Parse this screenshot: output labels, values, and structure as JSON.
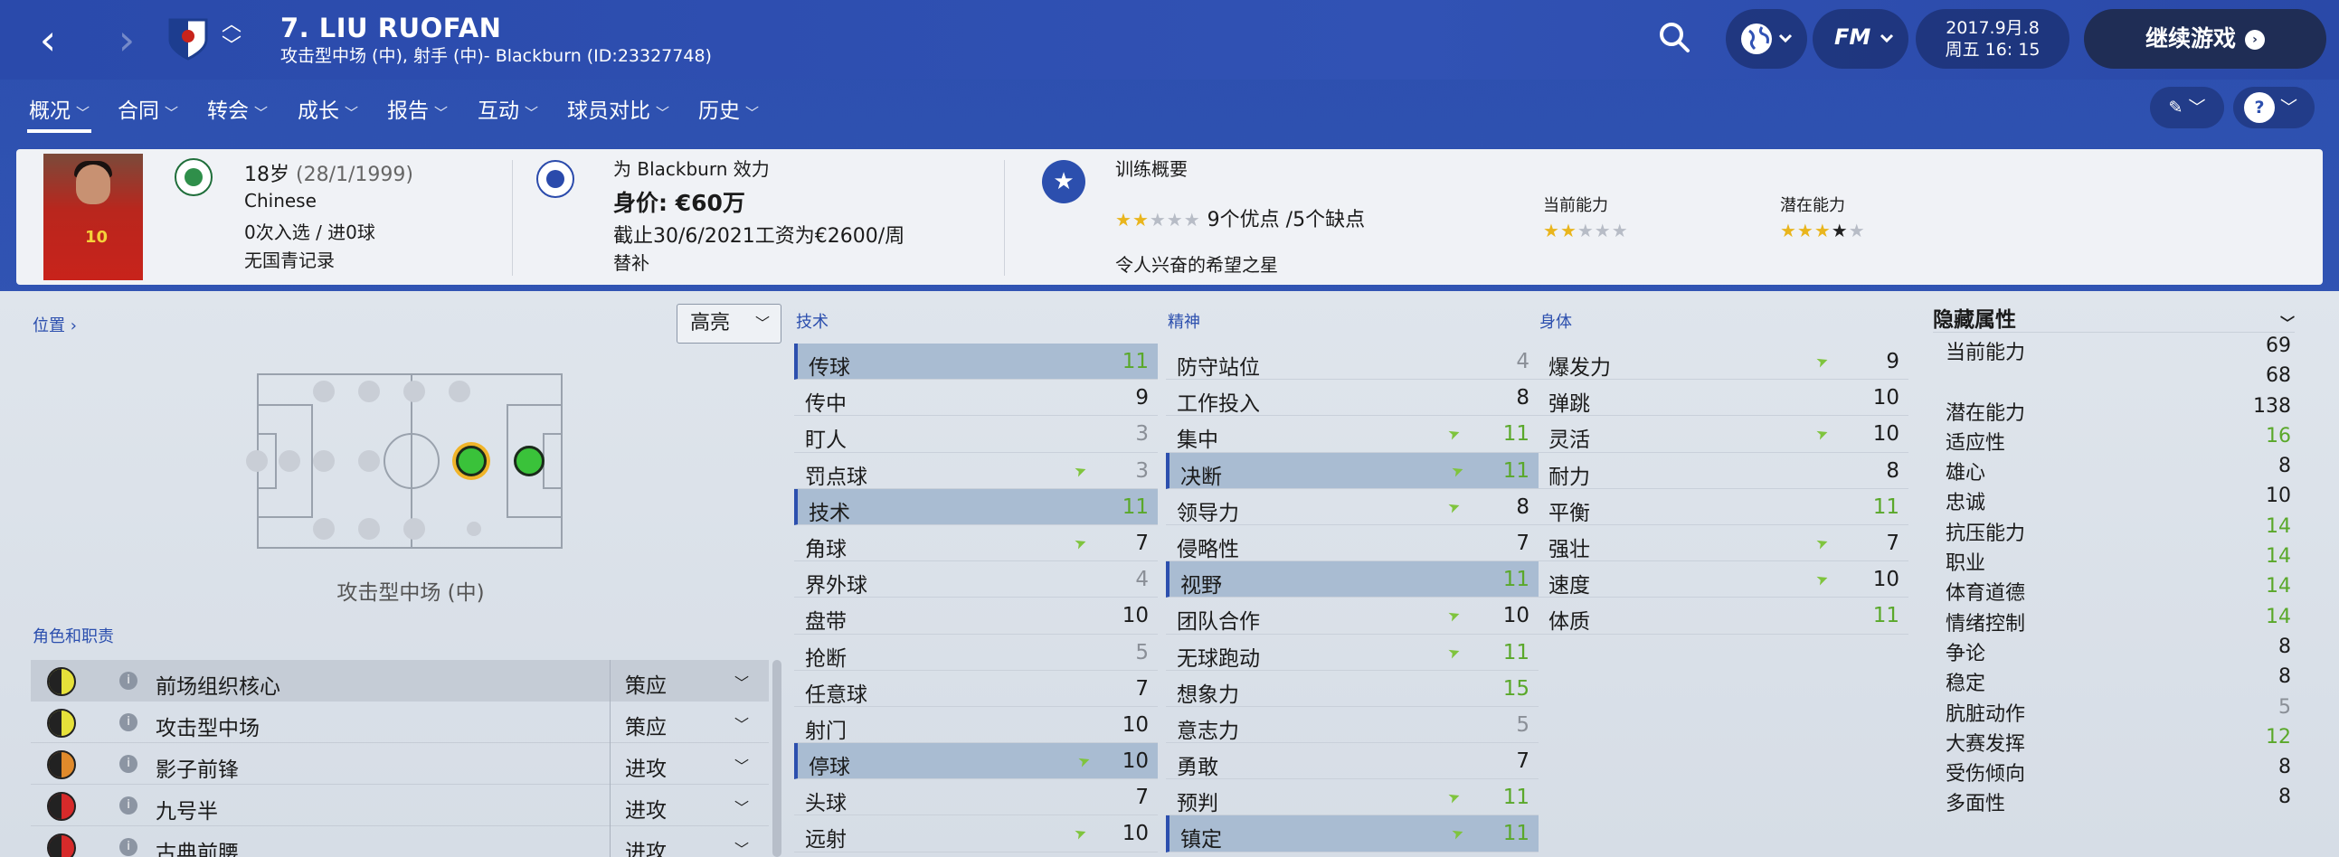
{
  "header": {
    "player_name": "7. LIU RUOFAN",
    "player_subtitle": "攻击型中场 (中), 射手 (中)- Blackburn (ID:23327748)",
    "date": "2017.9月.8",
    "weekday_time": "周五 16: 15",
    "continue_label": "继续游戏",
    "fm_label": "FM"
  },
  "tabs": [
    {
      "label": "概况"
    },
    {
      "label": "合同"
    },
    {
      "label": "转会"
    },
    {
      "label": "成长"
    },
    {
      "label": "报告"
    },
    {
      "label": "互动"
    },
    {
      "label": "球员对比"
    },
    {
      "label": "历史"
    }
  ],
  "info": {
    "age": "18岁",
    "dob": "(28/1/1999)",
    "nationality": "Chinese",
    "caps": "0次入选 / 进0球",
    "youth_record": "无国青记录",
    "plays_for": "为 Blackburn 效力",
    "value": "身价: €60万",
    "contract": "截止30/6/2021工资为€2600/周",
    "squad_status": "替补",
    "training_title": "训练概要",
    "traits": "9个优点 /5个缺点",
    "scout_comment": "令人兴奋的希望之星",
    "current_ability_label": "当前能力",
    "potential_ability_label": "潜在能力",
    "photo_number": "10"
  },
  "left": {
    "position_label": "位置",
    "highlight_label": "高亮",
    "position_name": "攻击型中场 (中)",
    "roles_label": "角色和职责",
    "roles": [
      {
        "name": "前场组织核心",
        "duty": "策应"
      },
      {
        "name": "攻击型中场",
        "duty": "策应"
      },
      {
        "name": "影子前锋",
        "duty": "进攻"
      },
      {
        "name": "九号半",
        "duty": "进攻"
      },
      {
        "name": "古典前腰",
        "duty": "进攻"
      }
    ]
  },
  "attributes": {
    "technical_label": "技术",
    "mental_label": "精神",
    "physical_label": "身体",
    "technical": [
      {
        "name": "传球",
        "value": "11",
        "hl": true
      },
      {
        "name": "传中",
        "value": "9"
      },
      {
        "name": "盯人",
        "value": "3"
      },
      {
        "name": "罚点球",
        "value": "3",
        "arrow": true
      },
      {
        "name": "技术",
        "value": "11",
        "hl": true
      },
      {
        "name": "角球",
        "value": "7",
        "arrow": true
      },
      {
        "name": "界外球",
        "value": "4"
      },
      {
        "name": "盘带",
        "value": "10"
      },
      {
        "name": "抢断",
        "value": "5"
      },
      {
        "name": "任意球",
        "value": "7"
      },
      {
        "name": "射门",
        "value": "10"
      },
      {
        "name": "停球",
        "value": "10",
        "hl": true,
        "arrow": true
      },
      {
        "name": "头球",
        "value": "7"
      },
      {
        "name": "远射",
        "value": "10",
        "arrow": true
      }
    ],
    "mental": [
      {
        "name": "防守站位",
        "value": "4"
      },
      {
        "name": "工作投入",
        "value": "8"
      },
      {
        "name": "集中",
        "value": "11",
        "arrow": true
      },
      {
        "name": "决断",
        "value": "11",
        "hl": true,
        "arrow": true
      },
      {
        "name": "领导力",
        "value": "8",
        "arrow": true
      },
      {
        "name": "侵略性",
        "value": "7"
      },
      {
        "name": "视野",
        "value": "11",
        "hl": true
      },
      {
        "name": "团队合作",
        "value": "10",
        "arrow": true
      },
      {
        "name": "无球跑动",
        "value": "11",
        "arrow": true
      },
      {
        "name": "想象力",
        "value": "15"
      },
      {
        "name": "意志力",
        "value": "5"
      },
      {
        "name": "勇敢",
        "value": "7"
      },
      {
        "name": "预判",
        "value": "11",
        "arrow": true
      },
      {
        "name": "镇定",
        "value": "11",
        "hl": true,
        "arrow": true
      }
    ],
    "physical": [
      {
        "name": "爆发力",
        "value": "9",
        "arrow": true
      },
      {
        "name": "弹跳",
        "value": "10"
      },
      {
        "name": "灵活",
        "value": "10",
        "arrow": true
      },
      {
        "name": "耐力",
        "value": "8"
      },
      {
        "name": "平衡",
        "value": "11"
      },
      {
        "name": "强壮",
        "value": "7",
        "arrow": true
      },
      {
        "name": "速度",
        "value": "10",
        "arrow": true
      },
      {
        "name": "体质",
        "value": "11"
      }
    ]
  },
  "hidden": {
    "title": "隐藏属性",
    "rows": [
      {
        "name": "当前能力",
        "value": "69"
      },
      {
        "name": "",
        "value": "68"
      },
      {
        "name": "潜在能力",
        "value": "138"
      },
      {
        "name": "适应性",
        "value": "16"
      },
      {
        "name": "雄心",
        "value": "8"
      },
      {
        "name": "忠诚",
        "value": "10"
      },
      {
        "name": "抗压能力",
        "value": "14"
      },
      {
        "name": "职业",
        "value": "14"
      },
      {
        "name": "体育道德",
        "value": "14"
      },
      {
        "name": "情绪控制",
        "value": "14"
      },
      {
        "name": "争论",
        "value": "8"
      },
      {
        "name": "稳定",
        "value": "8"
      },
      {
        "name": "肮脏动作",
        "value": "5"
      },
      {
        "name": "大赛发挥",
        "value": "12"
      },
      {
        "name": "受伤倾向",
        "value": "8"
      },
      {
        "name": "多面性",
        "value": "8"
      }
    ]
  },
  "ratings": {
    "training_stars": 1.5,
    "current_ability_stars": 1.5,
    "potential_ability_stars": 3.5
  },
  "colors": {
    "accent": "#2c4fae",
    "good": "#5aa82a",
    "poor": "#8a8f97",
    "arrow": "#7fc43d"
  }
}
